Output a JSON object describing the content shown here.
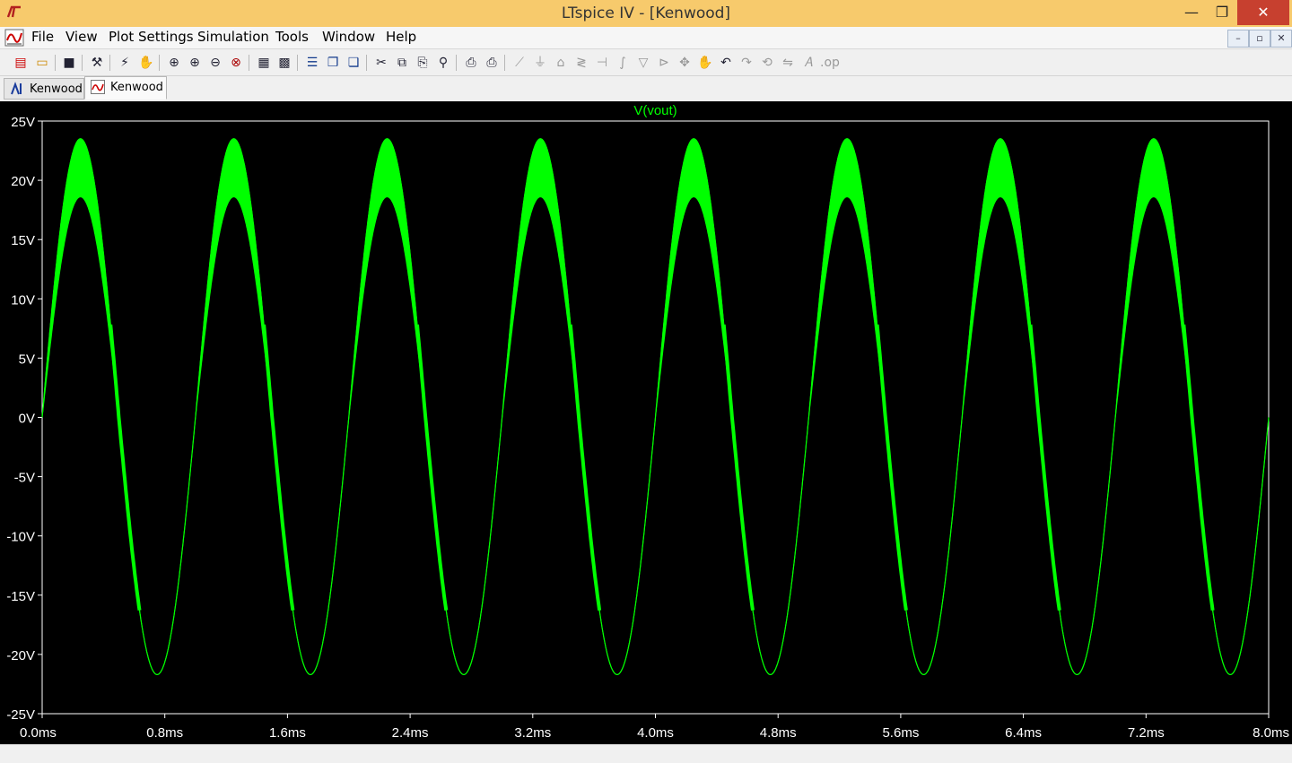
{
  "window": {
    "title": "LTspice IV - [Kenwood]",
    "minimize": "—",
    "maximize": "❐",
    "close": "✕"
  },
  "menu": [
    {
      "label": "File"
    },
    {
      "label": "View"
    },
    {
      "label": "Plot Settings"
    },
    {
      "label": "Simulation"
    },
    {
      "label": "Tools"
    },
    {
      "label": "Window"
    },
    {
      "label": "Help"
    }
  ],
  "mdi": {
    "minimize": "–",
    "restore": "▫",
    "close": "✕"
  },
  "tabs": [
    {
      "label": "Kenwood",
      "icon": "schematic-icon",
      "active": false
    },
    {
      "label": "Kenwood",
      "icon": "waveform-icon",
      "active": true
    }
  ],
  "colors": {
    "titlebar": "#f7ca6c",
    "plot_background": "#000000",
    "trace": "#00ff00",
    "axis_text": "#ffffff"
  },
  "chart_data": {
    "type": "line",
    "title": "V(vout)",
    "xlabel": "",
    "ylabel": "",
    "xlim": [
      0.0,
      8.0
    ],
    "ylim": [
      -25,
      25
    ],
    "x_unit": "ms",
    "y_unit": "V",
    "x_ticks": [
      "0.0ms",
      "0.8ms",
      "1.6ms",
      "2.4ms",
      "3.2ms",
      "4.0ms",
      "4.8ms",
      "5.6ms",
      "6.4ms",
      "7.2ms",
      "8.0ms"
    ],
    "y_ticks": [
      "25V",
      "20V",
      "15V",
      "10V",
      "5V",
      "0V",
      "-5V",
      "-10V",
      "-15V",
      "-20V",
      "-25V"
    ],
    "y_tick_values": [
      25,
      20,
      15,
      10,
      5,
      0,
      -5,
      -10,
      -15,
      -20,
      -25
    ],
    "x_tick_values": [
      0.0,
      0.8,
      1.6,
      2.4,
      3.2,
      4.0,
      4.8,
      5.6,
      6.4,
      7.2,
      8.0
    ],
    "series": [
      {
        "name": "V(vout)",
        "frequency_khz": 1.0,
        "peak_upper_v": 23.5,
        "peak_upper_inner_v": 18.6,
        "trough_v": -21.7,
        "start_v": 0,
        "note_band": "positive half-cycles show a filled high-frequency band; negative half-cycles are a thin line"
      }
    ],
    "grid": false
  }
}
